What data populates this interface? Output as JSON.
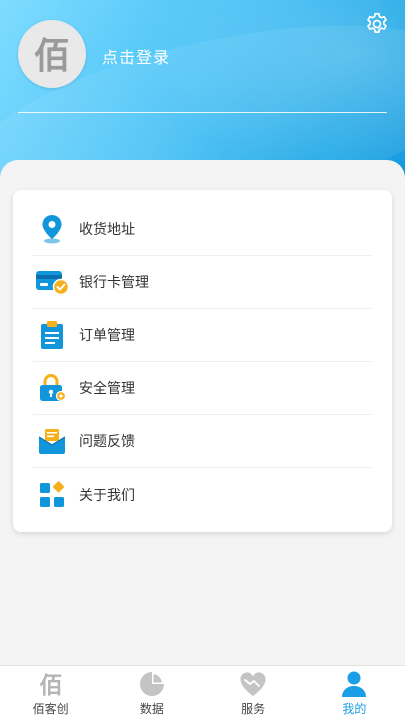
{
  "header": {
    "login_label": "点击登录",
    "avatar_glyph": "佰",
    "settings_icon": "gear-icon"
  },
  "menu": {
    "items": [
      {
        "label": "收货地址",
        "icon": "location-pin-icon"
      },
      {
        "label": "银行卡管理",
        "icon": "bank-card-icon"
      },
      {
        "label": "订单管理",
        "icon": "clipboard-order-icon"
      },
      {
        "label": "安全管理",
        "icon": "lock-icon"
      },
      {
        "label": "问题反馈",
        "icon": "feedback-mail-icon"
      },
      {
        "label": "关于我们",
        "icon": "apps-grid-icon"
      }
    ]
  },
  "tabbar": {
    "tabs": [
      {
        "label": "佰客创",
        "icon": "brand-logo-icon",
        "glyph": "佰"
      },
      {
        "label": "数据",
        "icon": "pie-chart-icon"
      },
      {
        "label": "服务",
        "icon": "heart-icon"
      },
      {
        "label": "我的",
        "icon": "user-icon"
      }
    ],
    "active_index": 3
  },
  "colors": {
    "accent": "#1a9ee5",
    "icon_blue": "#1296db",
    "icon_yellow": "#f5b01c"
  }
}
